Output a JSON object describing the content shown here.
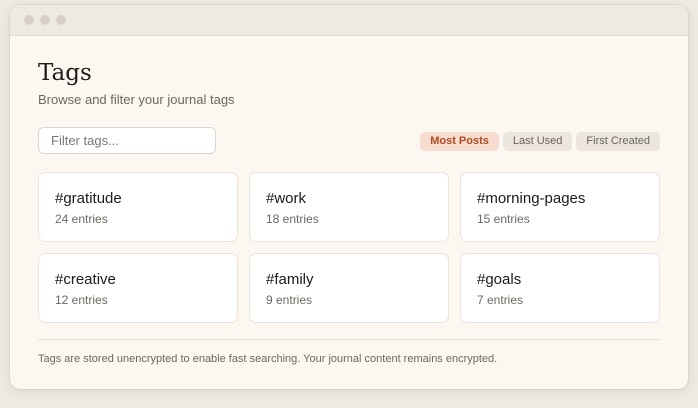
{
  "window": {
    "controls": [
      "close",
      "minimize",
      "zoom"
    ]
  },
  "header": {
    "title": "Tags",
    "subtitle": "Browse and filter your journal tags"
  },
  "filter": {
    "value": "",
    "placeholder": "Filter tags..."
  },
  "sort": {
    "options": [
      "Most Posts",
      "Last Used",
      "First Created"
    ],
    "selected": "Most Posts"
  },
  "tags": [
    {
      "name": "#gratitude",
      "count": "24 entries"
    },
    {
      "name": "#work",
      "count": "18 entries"
    },
    {
      "name": "#morning-pages",
      "count": "15 entries"
    },
    {
      "name": "#creative",
      "count": "12 entries"
    },
    {
      "name": "#family",
      "count": "9 entries"
    },
    {
      "name": "#goals",
      "count": "7 entries"
    }
  ],
  "footer": {
    "note": "Tags are stored unencrypted to enable fast searching. Your journal content remains encrypted."
  },
  "colors": {
    "accent": "#b04a22",
    "accent_bg": "#f6ddd0",
    "background": "#fdf7f1"
  }
}
